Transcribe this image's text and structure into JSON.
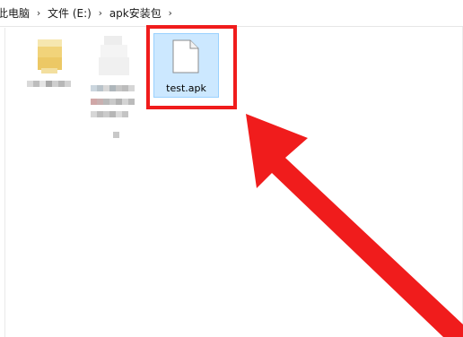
{
  "breadcrumb": {
    "items": [
      "此电脑",
      "文件 (E:)",
      "apk安装包"
    ],
    "separator": "›"
  },
  "files": [
    {
      "name": "test.apk",
      "selected": true,
      "icon": "generic-file-icon"
    }
  ],
  "annotation": {
    "highlight_color": "#f01c1c",
    "arrow_color": "#f01c1c"
  },
  "colors": {
    "selection_fill": "#cce8ff",
    "selection_border": "#99d1ff"
  }
}
